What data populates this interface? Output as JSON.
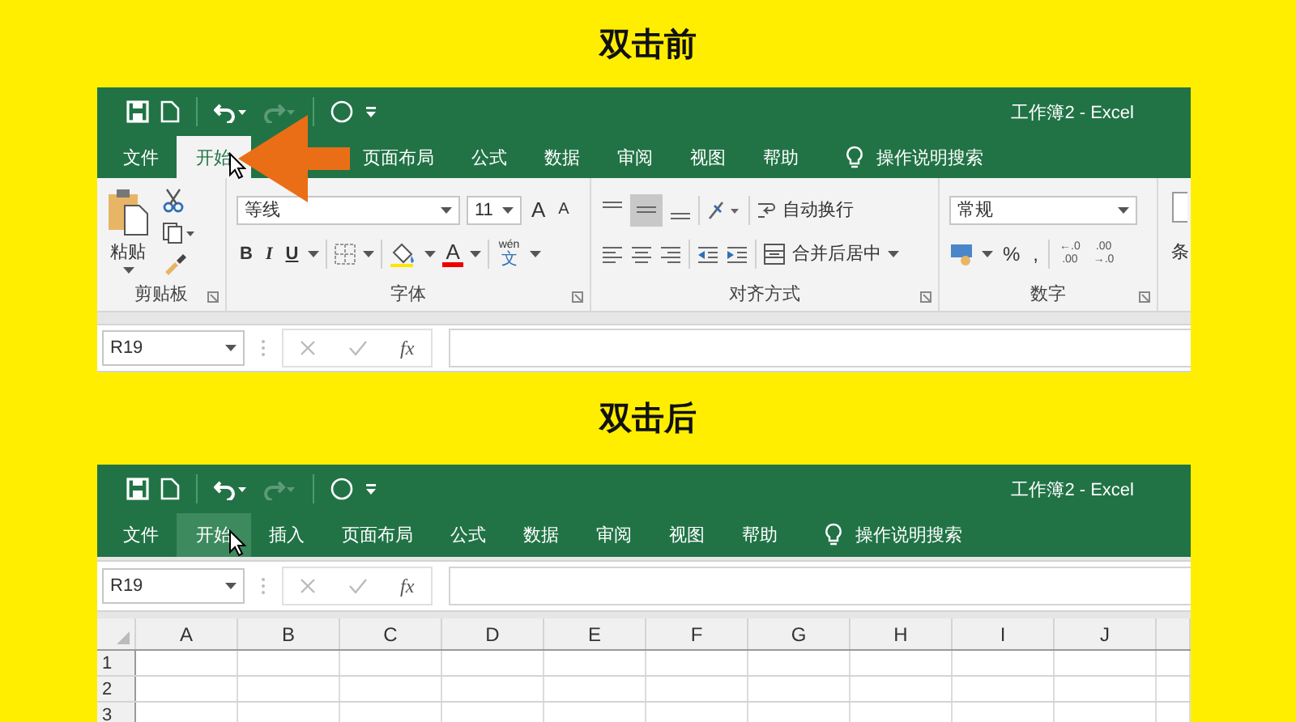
{
  "screens": [
    {
      "heading": "双击前",
      "title": "工作簿2 - Excel",
      "annotation_arrow": true,
      "ribbon_expanded": true,
      "tabs": [
        {
          "label": "文件",
          "selected": false
        },
        {
          "label": "开始",
          "selected": true
        },
        {
          "label": "页面布局",
          "selected": false
        },
        {
          "label": "公式",
          "selected": false
        },
        {
          "label": "数据",
          "selected": false
        },
        {
          "label": "审阅",
          "selected": false
        },
        {
          "label": "视图",
          "selected": false
        },
        {
          "label": "帮助",
          "selected": false
        }
      ],
      "tell_me": "操作说明搜索",
      "ribbon": {
        "groups": [
          {
            "kind": "clipboard",
            "label": "剪贴板",
            "paste": "粘贴"
          },
          {
            "kind": "font",
            "label": "字体",
            "font": "等线",
            "size": "11",
            "grow": "A",
            "shrink": "A",
            "styles": [
              "B",
              "I",
              "U"
            ],
            "font_color": "A",
            "phonetic_top": "wén",
            "phonetic": "文"
          },
          {
            "kind": "alignment",
            "label": "对齐方式",
            "wrap": "自动换行",
            "merge": "合并后居中"
          },
          {
            "kind": "number",
            "label": "数字",
            "format": "常规",
            "percent": "%",
            "comma": ",",
            "increase_decimal": [
              "←.0",
              ".00"
            ],
            "decrease_decimal": [
              ".00",
              "→.0"
            ]
          },
          {
            "kind": "partial",
            "label": "条"
          }
        ]
      },
      "name_box": "R19",
      "fx": "fx"
    },
    {
      "heading": "双击后",
      "title": "工作簿2 - Excel",
      "annotation_arrow": false,
      "ribbon_expanded": false,
      "tabs": [
        {
          "label": "文件",
          "selected": false
        },
        {
          "label": "开始",
          "selected": true
        },
        {
          "label": "插入",
          "selected": false
        },
        {
          "label": "页面布局",
          "selected": false
        },
        {
          "label": "公式",
          "selected": false
        },
        {
          "label": "数据",
          "selected": false
        },
        {
          "label": "审阅",
          "selected": false
        },
        {
          "label": "视图",
          "selected": false
        },
        {
          "label": "帮助",
          "selected": false
        }
      ],
      "tell_me": "操作说明搜索",
      "name_box": "R19",
      "fx": "fx",
      "grid": {
        "columns": [
          "A",
          "B",
          "C",
          "D",
          "E",
          "F",
          "G",
          "H",
          "I",
          "J"
        ],
        "rows": [
          "1",
          "2",
          "3"
        ]
      }
    }
  ]
}
